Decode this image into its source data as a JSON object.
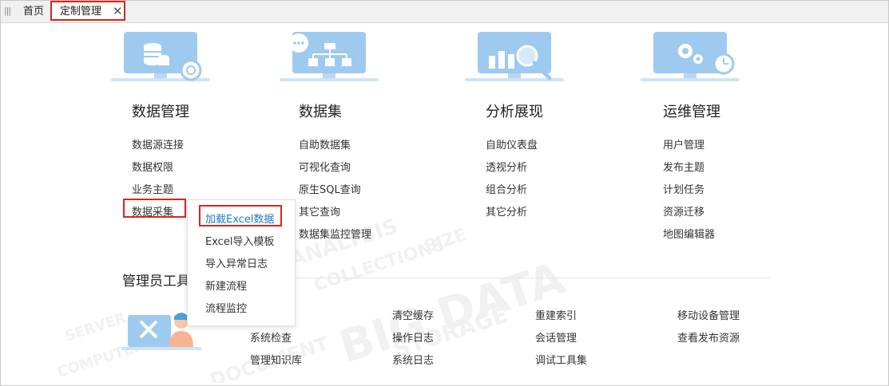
{
  "tabs": {
    "home": "首页",
    "active": "定制管理",
    "close": "✕"
  },
  "categories": [
    {
      "title": "数据管理",
      "icon": "database-gear-icon",
      "links": [
        "数据源连接",
        "数据权限",
        "业务主题",
        "数据采集"
      ]
    },
    {
      "title": "数据集",
      "icon": "dataset-tree-icon",
      "links": [
        "自助数据集",
        "可视化查询",
        "原生SQL查询",
        "其它查询",
        "数据集监控管理"
      ]
    },
    {
      "title": "分析展现",
      "icon": "chart-magnifier-icon",
      "links": [
        "自助仪表盘",
        "透视分析",
        "组合分析",
        "其它分析"
      ]
    },
    {
      "title": "运维管理",
      "icon": "gears-clock-icon",
      "links": [
        "用户管理",
        "发布主题",
        "计划任务",
        "资源迁移",
        "地图编辑器"
      ]
    }
  ],
  "dropdown": {
    "items": [
      "加载Excel数据",
      "Excel导入模板",
      "导入异常日志",
      "新建流程",
      "流程监控"
    ]
  },
  "admin": {
    "title": "管理员工具",
    "columns": [
      [
        "系统检查",
        "管理知识库"
      ],
      [
        "清空缓存",
        "操作日志",
        "系统日志"
      ],
      [
        "重建索引",
        "会话管理",
        "调试工具集"
      ],
      [
        "移动设备管理",
        "查看发布资源"
      ]
    ]
  },
  "colors": {
    "highlight": "#d9261c",
    "link_active": "#1f7bc6",
    "icon_blue": "#9fcaef"
  },
  "watermark": [
    "ANALYSIS",
    "COLLECTIONS",
    "SIZE",
    "BIG DATA",
    "STORAGE",
    "DOCUMENT",
    "SERVER",
    "COMPUTER"
  ]
}
